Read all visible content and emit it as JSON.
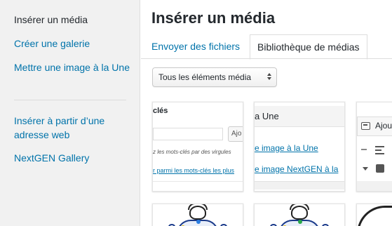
{
  "sidebar": {
    "items": [
      {
        "label": "Insérer un média",
        "active": true
      },
      {
        "label": "Créer une galerie",
        "active": false
      },
      {
        "label": "Mettre une image à la Une",
        "active": false
      },
      {
        "label": "Insérer à partir d’une adresse web",
        "active": false
      },
      {
        "label": "NextGEN Gallery",
        "active": false
      }
    ]
  },
  "main": {
    "title": "Insérer un média",
    "tabs": [
      {
        "label": "Envoyer des fichiers",
        "active": false
      },
      {
        "label": "Bibliothèque de médias",
        "active": true
      }
    ],
    "filter": {
      "selected": "Tous les éléments média"
    }
  },
  "thumbnails": {
    "t1": {
      "heading": "clés",
      "button": "Ajo",
      "hint": "z les mots-clés par des virgules",
      "link": "r parmi les mots-clés les plus"
    },
    "t2": {
      "heading": "a Une",
      "link1": "e image à la Une",
      "link2": "e image NextGEN à la"
    },
    "t3": {
      "label": "Ajou"
    }
  },
  "colors": {
    "link": "#0073aa",
    "text": "#23282d",
    "sidebar_bg": "#f1f1f1",
    "border": "#dddddd",
    "figure_outline": "#1a3a8a",
    "badge_blue": "#2a7de1",
    "badge_green": "#2aa84a",
    "badge_yellow": "#e6b800"
  }
}
